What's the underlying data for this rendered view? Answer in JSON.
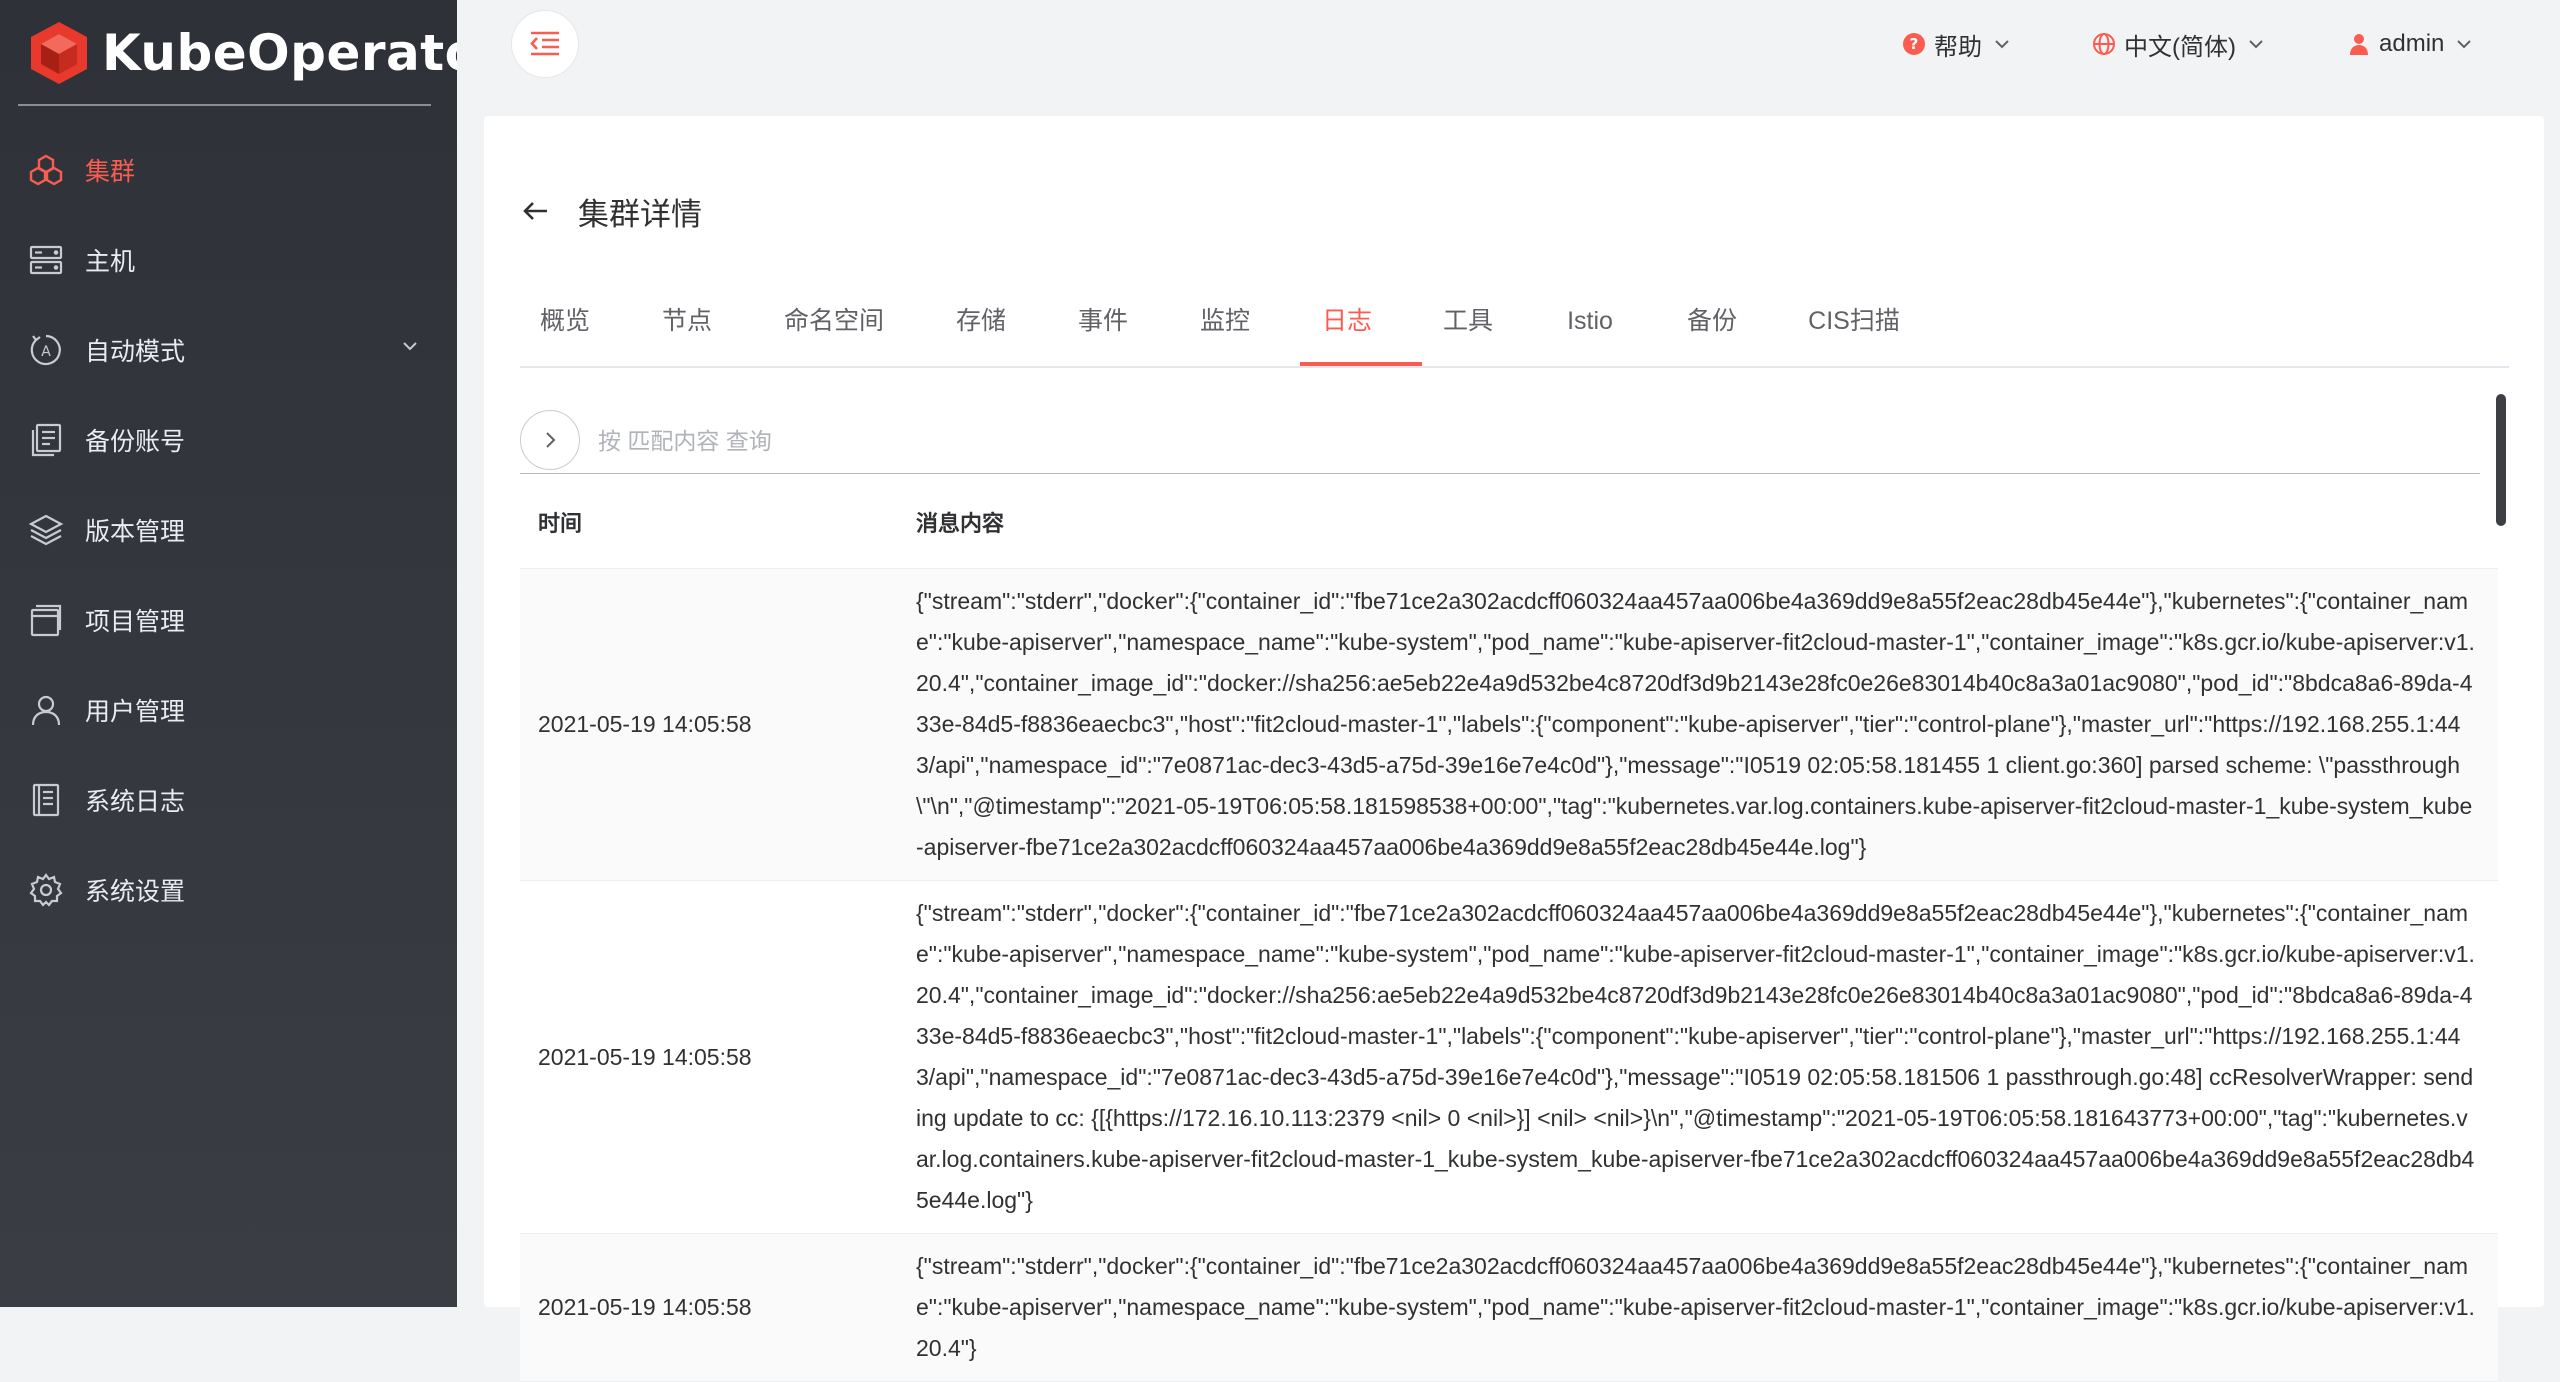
{
  "app": {
    "name": "KubeOperator"
  },
  "sidebar": {
    "items": [
      {
        "label": "集群",
        "icon": "cluster-icon",
        "active": true
      },
      {
        "label": "主机",
        "icon": "host-icon"
      },
      {
        "label": "自动模式",
        "icon": "auto-mode-icon",
        "expandable": true
      },
      {
        "label": "备份账号",
        "icon": "backup-account-icon"
      },
      {
        "label": "版本管理",
        "icon": "version-icon"
      },
      {
        "label": "项目管理",
        "icon": "project-icon"
      },
      {
        "label": "用户管理",
        "icon": "user-icon"
      },
      {
        "label": "系统日志",
        "icon": "system-log-icon"
      },
      {
        "label": "系统设置",
        "icon": "settings-icon"
      }
    ]
  },
  "header": {
    "help": "帮助",
    "language": "中文(简体)",
    "user": "admin"
  },
  "page": {
    "title": "集群详情",
    "tabs": [
      "概览",
      "节点",
      "命名空间",
      "存储",
      "事件",
      "监控",
      "日志",
      "工具",
      "Istio",
      "备份",
      "CIS扫描"
    ],
    "active_tab": "日志"
  },
  "search": {
    "placeholder": "按 匹配内容 查询"
  },
  "table": {
    "columns": {
      "time": "时间",
      "message": "消息内容"
    },
    "rows": [
      {
        "time": "2021-05-19 14:05:58",
        "message": "{\"stream\":\"stderr\",\"docker\":{\"container_id\":\"fbe71ce2a302acdcff060324aa457aa006be4a369dd9e8a55f2eac28db45e44e\"},\"kubernetes\":{\"container_name\":\"kube-apiserver\",\"namespace_name\":\"kube-system\",\"pod_name\":\"kube-apiserver-fit2cloud-master-1\",\"container_image\":\"k8s.gcr.io/kube-apiserver:v1.20.4\",\"container_image_id\":\"docker://sha256:ae5eb22e4a9d532be4c8720df3d9b2143e28fc0e26e83014b40c8a3a01ac9080\",\"pod_id\":\"8bdca8a6-89da-433e-84d5-f8836eaecbc3\",\"host\":\"fit2cloud-master-1\",\"labels\":{\"component\":\"kube-apiserver\",\"tier\":\"control-plane\"},\"master_url\":\"https://192.168.255.1:443/api\",\"namespace_id\":\"7e0871ac-dec3-43d5-a75d-39e16e7e4c0d\"},\"message\":\"I0519 02:05:58.181455 1 client.go:360] parsed scheme: \\\"passthrough\\\"\\n\",\"@timestamp\":\"2021-05-19T06:05:58.181598538+00:00\",\"tag\":\"kubernetes.var.log.containers.kube-apiserver-fit2cloud-master-1_kube-system_kube-apiserver-fbe71ce2a302acdcff060324aa457aa006be4a369dd9e8a55f2eac28db45e44e.log\"}"
      },
      {
        "time": "2021-05-19 14:05:58",
        "message": "{\"stream\":\"stderr\",\"docker\":{\"container_id\":\"fbe71ce2a302acdcff060324aa457aa006be4a369dd9e8a55f2eac28db45e44e\"},\"kubernetes\":{\"container_name\":\"kube-apiserver\",\"namespace_name\":\"kube-system\",\"pod_name\":\"kube-apiserver-fit2cloud-master-1\",\"container_image\":\"k8s.gcr.io/kube-apiserver:v1.20.4\",\"container_image_id\":\"docker://sha256:ae5eb22e4a9d532be4c8720df3d9b2143e28fc0e26e83014b40c8a3a01ac9080\",\"pod_id\":\"8bdca8a6-89da-433e-84d5-f8836eaecbc3\",\"host\":\"fit2cloud-master-1\",\"labels\":{\"component\":\"kube-apiserver\",\"tier\":\"control-plane\"},\"master_url\":\"https://192.168.255.1:443/api\",\"namespace_id\":\"7e0871ac-dec3-43d5-a75d-39e16e7e4c0d\"},\"message\":\"I0519 02:05:58.181506 1 passthrough.go:48] ccResolverWrapper: sending update to cc: {[{https://172.16.10.113:2379 <nil> 0 <nil>}] <nil> <nil>}\\n\",\"@timestamp\":\"2021-05-19T06:05:58.181643773+00:00\",\"tag\":\"kubernetes.var.log.containers.kube-apiserver-fit2cloud-master-1_kube-system_kube-apiserver-fbe71ce2a302acdcff060324aa457aa006be4a369dd9e8a55f2eac28db45e44e.log\"}"
      },
      {
        "time": "2021-05-19 14:05:58",
        "message": "{\"stream\":\"stderr\",\"docker\":{\"container_id\":\"fbe71ce2a302acdcff060324aa457aa006be4a369dd9e8a55f2eac28db45e44e\"},\"kubernetes\":{\"container_name\":\"kube-apiserver\",\"namespace_name\":\"kube-system\",\"pod_name\":\"kube-apiserver-fit2cloud-master-1\",\"container_image\":\"k8s.gcr.io/kube-apiserver:v1.20.4\"}"
      }
    ]
  },
  "colors": {
    "accent": "#fa5d50",
    "sidebar_bg": "#2e3238"
  }
}
